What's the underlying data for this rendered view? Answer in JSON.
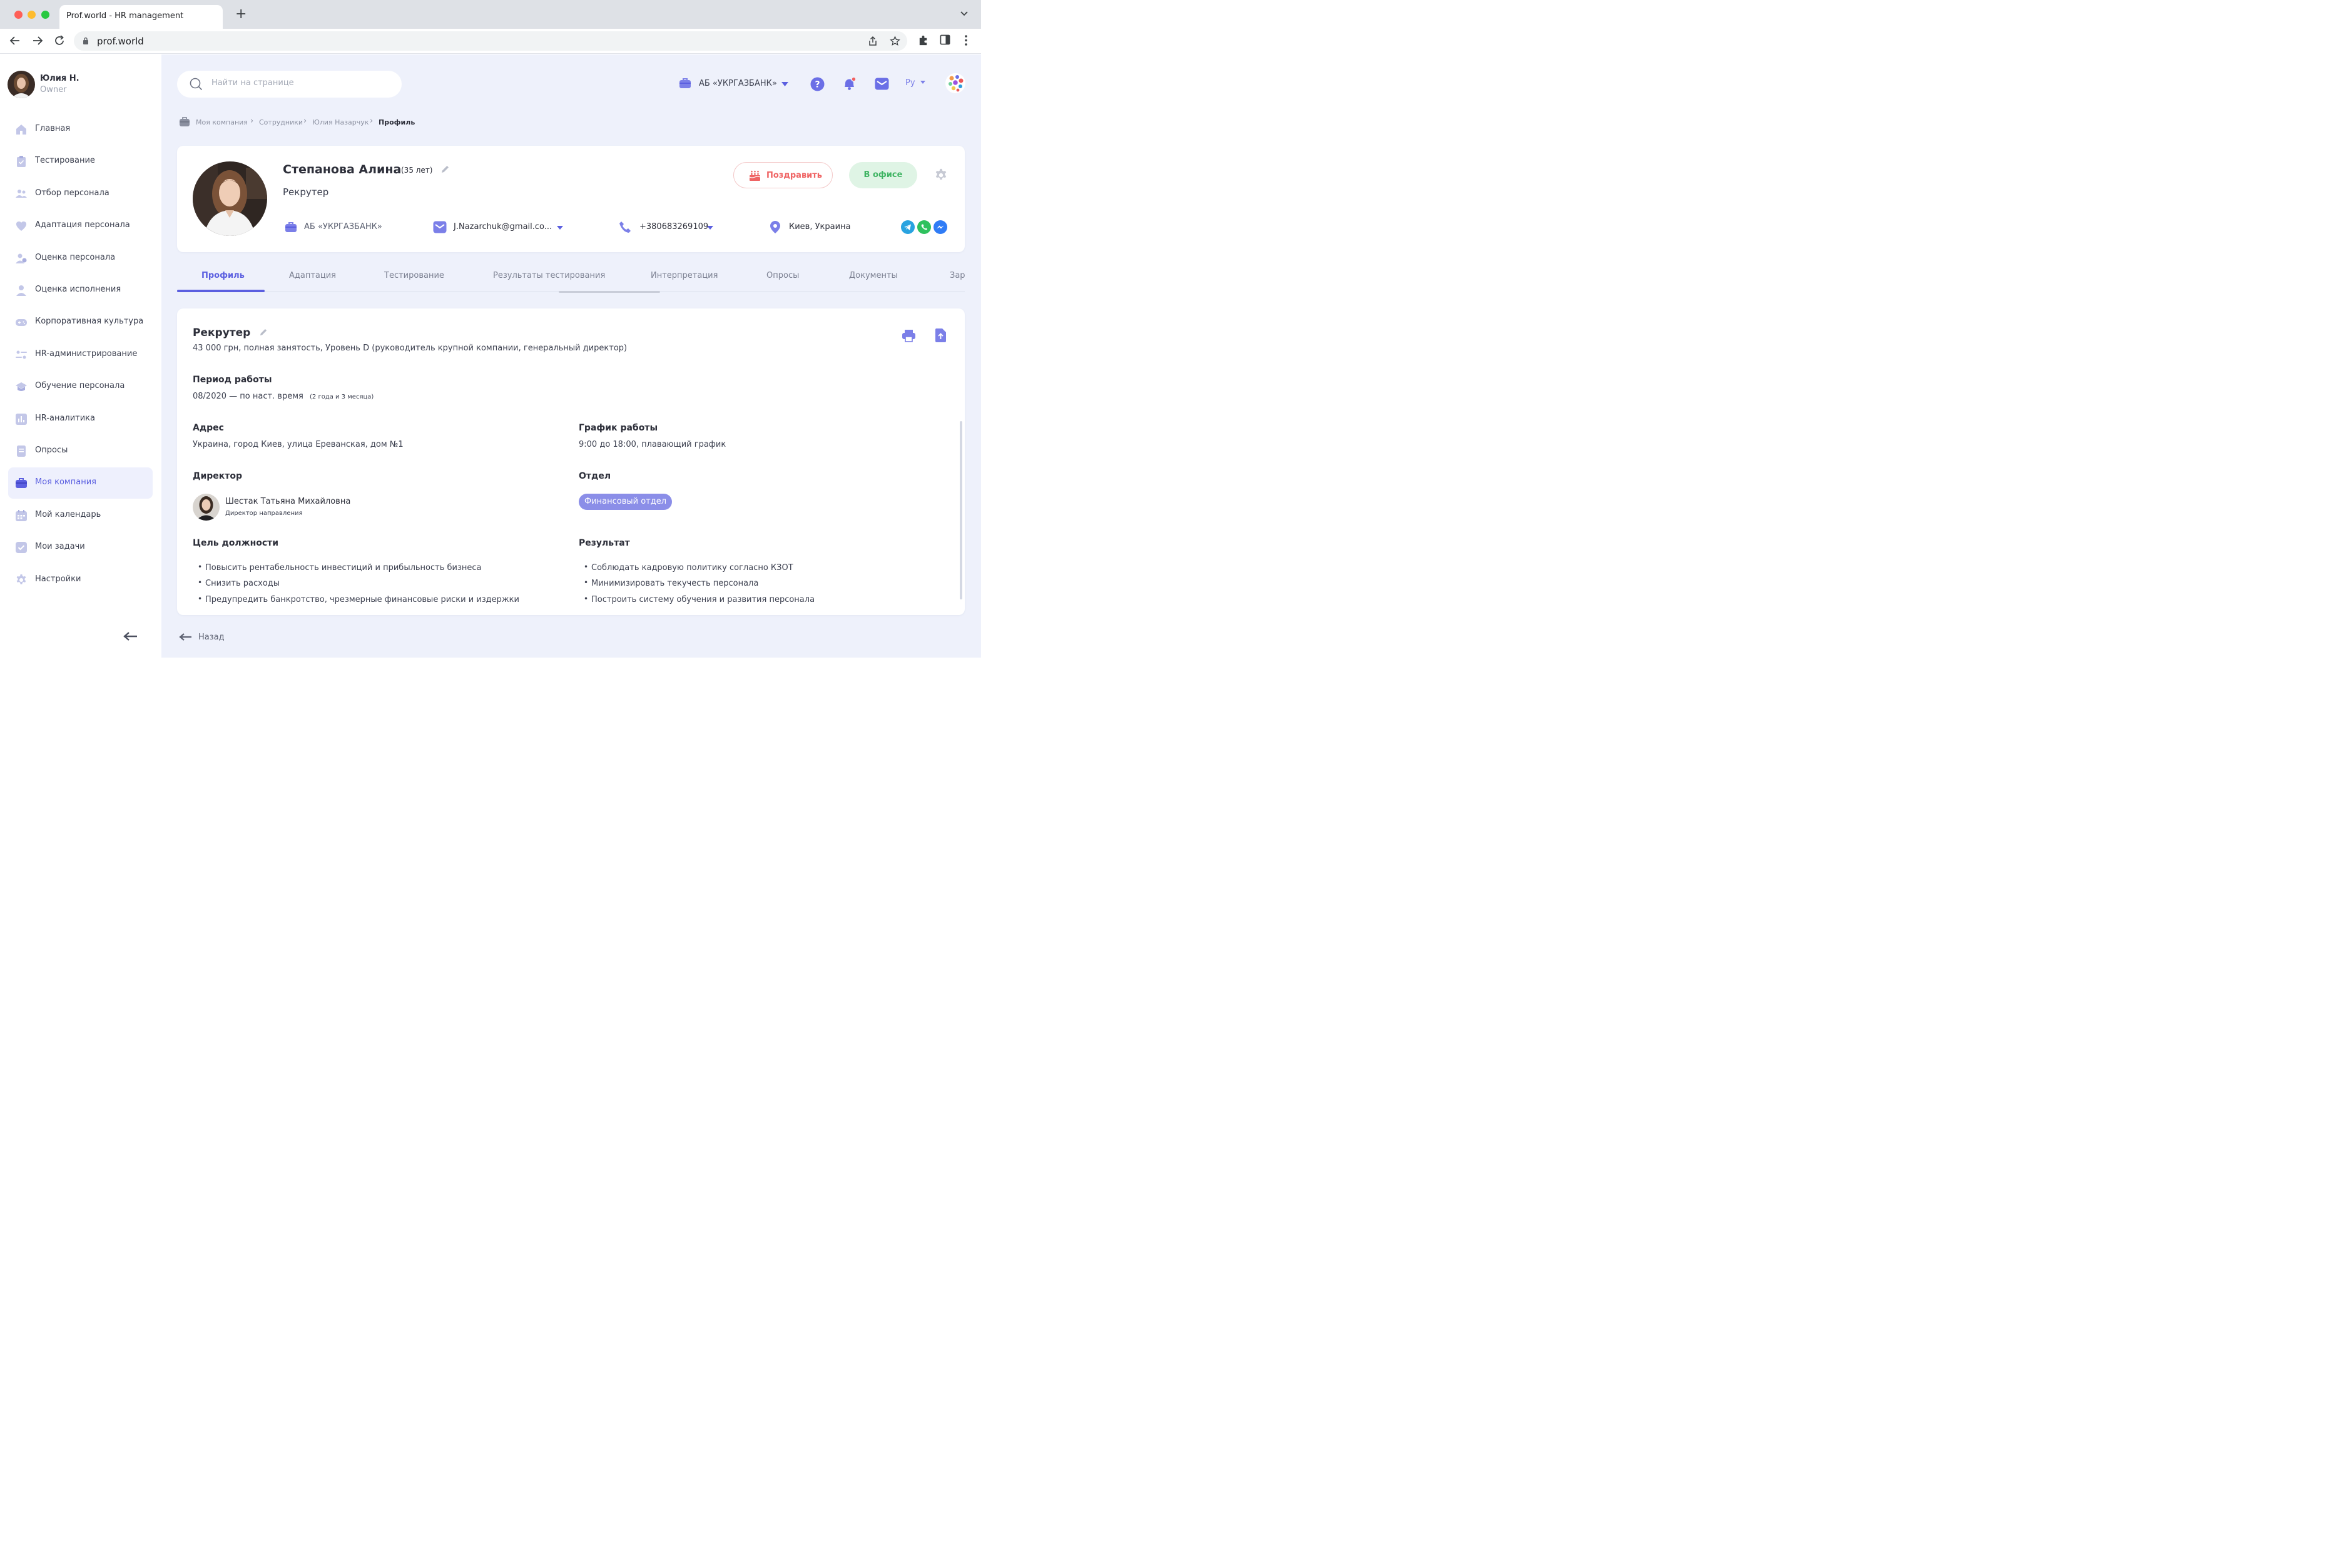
{
  "browser": {
    "tab_title": "Prof.world  - HR management",
    "url": "prof.world"
  },
  "user": {
    "name": "Юлия Н.",
    "role": "Owner"
  },
  "sidebar": {
    "items": [
      {
        "label": "Главная",
        "icon": "home-icon"
      },
      {
        "label": "Тестирование",
        "icon": "clipboard-icon"
      },
      {
        "label": "Отбор персонала",
        "icon": "people-icon"
      },
      {
        "label": "Адаптация персонала",
        "icon": "heart-icon"
      },
      {
        "label": "Оценка персонала",
        "icon": "user-check-icon"
      },
      {
        "label": "Оценка исполнения",
        "icon": "user-icon"
      },
      {
        "label": "Корпоративная культура",
        "icon": "gamepad-icon"
      },
      {
        "label": "HR-администрирование",
        "icon": "sliders-icon"
      },
      {
        "label": "Обучение персонала",
        "icon": "graduation-cap-icon"
      },
      {
        "label": "HR-аналитика",
        "icon": "bar-chart-icon"
      },
      {
        "label": "Опросы",
        "icon": "document-icon"
      },
      {
        "label": "Моя компания",
        "icon": "briefcase-icon",
        "active": true
      },
      {
        "label": "Мой календарь",
        "icon": "calendar-icon"
      },
      {
        "label": "Мои задачи",
        "icon": "checkbox-icon"
      },
      {
        "label": "Настройки",
        "icon": "gear-icon"
      }
    ]
  },
  "header": {
    "search_placeholder": "Найти на странице",
    "company": "АБ «УКРГАЗБАНК»",
    "language": "Ру"
  },
  "breadcrumb": {
    "items": [
      "Моя компания",
      "Сотрудники",
      "Юлия Назарчук"
    ],
    "current": "Профиль"
  },
  "profile": {
    "name": "Степанова Алина",
    "age": "(35 лет)",
    "position": "Рекрутер",
    "congrats_label": "Поздравить",
    "status_label": "В офисе",
    "company": "АБ «УКРГАЗБАНК»",
    "email": "J.Nazarchuk@gmail.co...",
    "phone": "+380683269109",
    "location": "Киев, Украина"
  },
  "tabs": [
    {
      "label": "Профиль",
      "active": true
    },
    {
      "label": "Адаптация"
    },
    {
      "label": "Тестирование"
    },
    {
      "label": "Результаты тестирования"
    },
    {
      "label": "Интерпретация"
    },
    {
      "label": "Опросы"
    },
    {
      "label": "Документы"
    },
    {
      "label": "Зар"
    }
  ],
  "details": {
    "title": "Рекрутер",
    "subtitle": "43 000 грн, полная занятость, Уровень D (руководитель крупной компании, генеральный директор)",
    "period_heading": "Период работы",
    "period": "08/2020 — по наст. время",
    "period_duration": "(2 года и 3 месяца)",
    "address_heading": "Адрес",
    "address": "Украина, город Киев, улица Ереванская, дом №1",
    "schedule_heading": "График работы",
    "schedule": "9:00 до 18:00, плавающий график",
    "director_heading": "Директор",
    "director_name": "Шестак Татьяна Михайловна",
    "director_role": "Директор направления",
    "department_heading": "Отдел",
    "department": "Финансовый отдел",
    "goal_heading": "Цель должности",
    "goals": [
      "Повысить рентабельность инвестиций и прибыльность бизнеса",
      "Снизить расходы",
      "Предупредить банкротство, чрезмерные финансовые риски и издержки"
    ],
    "result_heading": "Результат",
    "results": [
      "Соблюдать кадровую политику согласно КЗОТ",
      "Минимизировать текучесть персонала",
      "Построить систему обучения и развития персонала"
    ]
  },
  "back_label": "Назад",
  "colors": {
    "accent": "#5b5fe0",
    "main_bg": "#eef1fb",
    "congrats": "#ef6464",
    "office_green": "#3fb463",
    "badge": "#8b8ee8"
  }
}
